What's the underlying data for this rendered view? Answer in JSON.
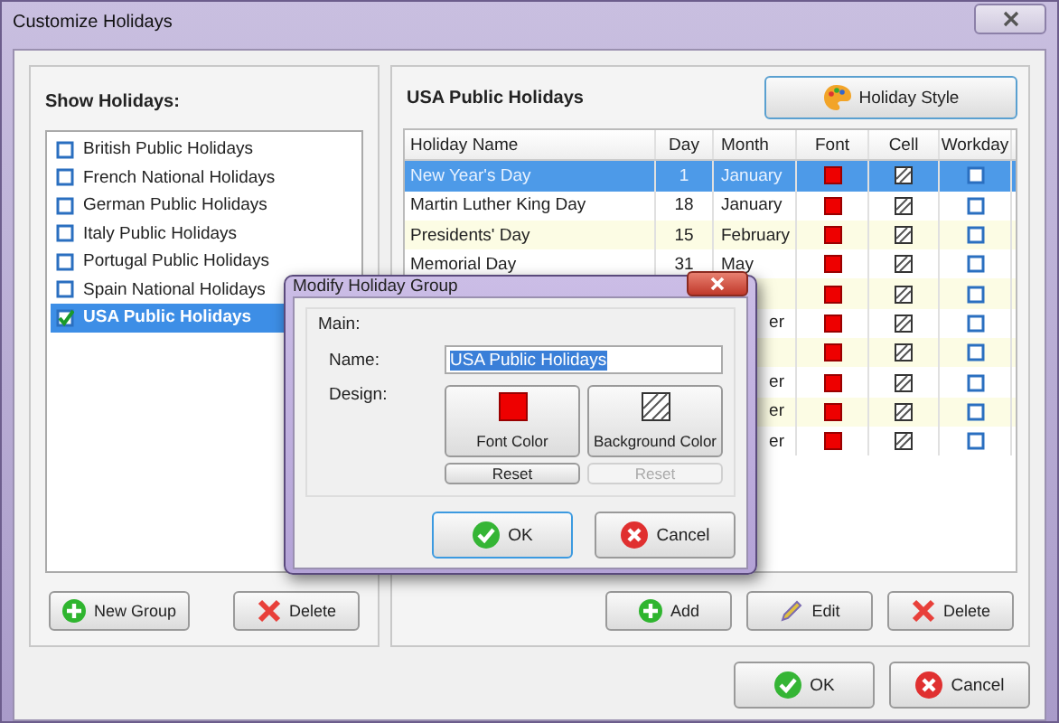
{
  "window": {
    "title": "Customize Holidays"
  },
  "left": {
    "heading": "Show Holidays:",
    "items": [
      {
        "label": "British Public Holidays",
        "checked": false,
        "selected": false
      },
      {
        "label": "French National Holidays",
        "checked": false,
        "selected": false
      },
      {
        "label": "German Public Holidays",
        "checked": false,
        "selected": false
      },
      {
        "label": "Italy Public Holidays",
        "checked": false,
        "selected": false
      },
      {
        "label": "Portugal Public Holidays",
        "checked": false,
        "selected": false
      },
      {
        "label": "Spain National Holidays",
        "checked": false,
        "selected": false
      },
      {
        "label": "USA Public Holidays",
        "checked": true,
        "selected": true
      }
    ],
    "buttons": [
      {
        "label": "New Group",
        "kind": "add"
      },
      {
        "label": "Delete",
        "kind": "delete"
      }
    ]
  },
  "right": {
    "heading": "USA Public Holidays",
    "style_button": "Holiday Style",
    "columns": [
      "Holiday Name",
      "Day",
      "Month",
      "Font",
      "Cell",
      "Workday"
    ],
    "rows": [
      {
        "name": "New Year's Day",
        "day": "1",
        "month": "January",
        "workday": false,
        "selected": true
      },
      {
        "name": "Martin Luther King Day",
        "day": "18",
        "month": "January",
        "workday": false,
        "selected": false
      },
      {
        "name": "Presidents' Day",
        "day": "15",
        "month": "February",
        "workday": false,
        "selected": false
      },
      {
        "name": "Memorial Day",
        "day": "31",
        "month": "May",
        "workday": false,
        "selected": false
      },
      {
        "workday": false,
        "selected": false
      },
      {
        "month_tail": "er",
        "workday": false,
        "selected": false
      },
      {
        "workday": false,
        "selected": false
      },
      {
        "month_tail": "er",
        "workday": false,
        "selected": false
      },
      {
        "month_tail": "er",
        "workday": false,
        "selected": false
      },
      {
        "month_tail": "er",
        "workday": false,
        "selected": false
      }
    ],
    "buttons": [
      {
        "label": "Add",
        "kind": "add"
      },
      {
        "label": "Edit",
        "kind": "edit"
      },
      {
        "label": "Delete",
        "kind": "delete"
      }
    ]
  },
  "dialog": {
    "title": "Modify Holiday Group",
    "section": "Main:",
    "name_label": "Name:",
    "name_value": "USA Public Holidays",
    "design_label": "Design:",
    "font_button": "Font Color",
    "background_button": "Background Color",
    "resets": [
      {
        "label": "Reset",
        "disabled": false
      },
      {
        "label": "Reset",
        "disabled": true
      }
    ],
    "ok": "OK",
    "cancel": "Cancel"
  },
  "footer": {
    "ok": "OK",
    "cancel": "Cancel"
  }
}
